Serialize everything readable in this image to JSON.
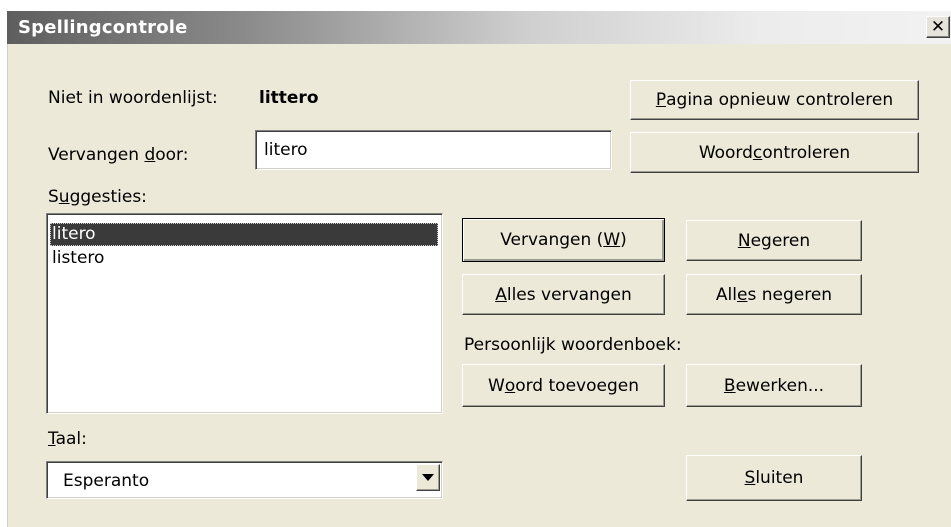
{
  "window": {
    "title": "Spellingcontrole",
    "close_glyph": "✕"
  },
  "not_in_dictionary": {
    "label": "Niet in woordenlijst:",
    "word": "littero"
  },
  "replace_with": {
    "label_pre": "Vervangen ",
    "label_key": "d",
    "label_post": "oor:",
    "value": "litero"
  },
  "suggestions": {
    "label_pre": "S",
    "label_key": "u",
    "label_post": "ggesties:",
    "items": [
      "litero",
      "listero"
    ],
    "selected_index": 0
  },
  "language": {
    "label_key": "T",
    "label_post": "aal:",
    "selected": "Esperanto"
  },
  "personal_dictionary_label": "Persoonlijk woordenboek:",
  "buttons": {
    "recheck_page": {
      "key": "P",
      "post": "agina opnieuw controleren"
    },
    "check_word": {
      "pre": "Woord ",
      "key": "c",
      "post": "ontroleren"
    },
    "replace": {
      "pre": "Vervangen (",
      "key": "W",
      "post": ")"
    },
    "ignore": {
      "key": "N",
      "post": "egeren"
    },
    "replace_all": {
      "key": "A",
      "post": "lles vervangen"
    },
    "ignore_all": {
      "pre": "All",
      "key": "e",
      "post": "s negeren"
    },
    "add_word": {
      "pre": "W",
      "key": "o",
      "post": "ord toevoegen"
    },
    "edit": {
      "key": "B",
      "post": "ewerken..."
    },
    "close": {
      "key": "S",
      "post": "luiten"
    }
  },
  "icons": {
    "dropdown": "chevron-down-icon",
    "close": "close-icon"
  }
}
